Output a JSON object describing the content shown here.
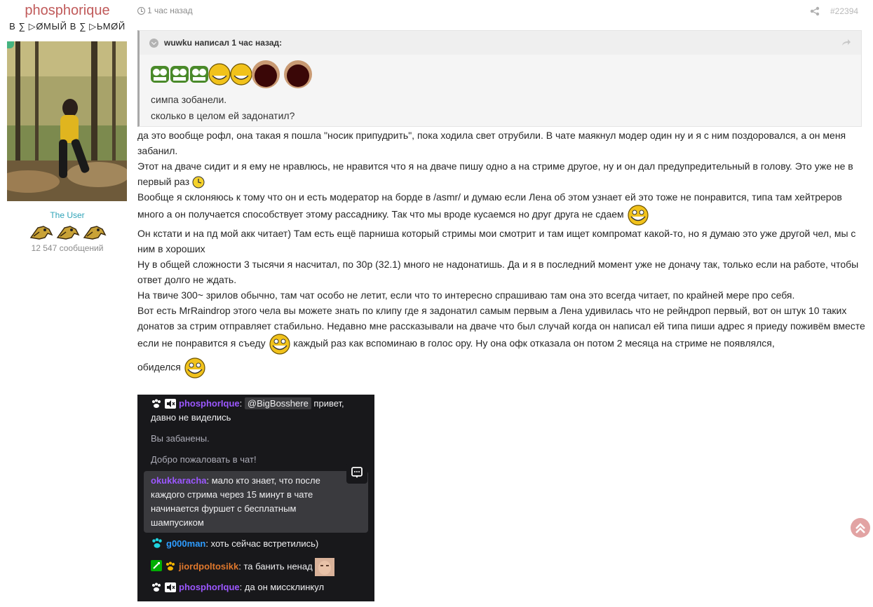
{
  "user": {
    "name": "phosphorique",
    "tagline": "В ∑ ▷ØМЫЙ В ∑ ▷ЬМØЙ",
    "role": "The User",
    "post_count": "12 547 сообщений",
    "badge_icons": [
      "pixel-bird-icon",
      "pixel-bird-icon",
      "pixel-bird-icon"
    ]
  },
  "post": {
    "time": "1 час назад",
    "number": "#22394"
  },
  "quote": {
    "author": "wuwku написал 1 час назад:",
    "emotes": [
      "pepe-laugh-icon",
      "pepe-laugh-icon",
      "pepe-laugh-icon",
      "troll-face-icon",
      "troll-face-icon",
      "screaming-face-icon",
      "screaming-face-icon"
    ],
    "lines": [
      "симпа зобанели.",
      "сколько в целом ей задонатил?"
    ]
  },
  "body": {
    "p1": "да это вообще рофл, она такая я пошла \"носик припудрить\", пока ходила свет отрубили. В чате маякнул модер один ну и я с ним поздоровался, а он меня забанил.",
    "p2": "Этот на дваче сидит и я ему не нравлюсь, не нравится что я на дваче пишу одно а на стриме другое, ну и он дал предупредительный в голову. Это уже не в первый раз",
    "p3": "Вообще я склоняюсь к тому что он и есть модератор на борде в /asmr/ и думаю если Лена об этом узнает ей это тоже не понравится, типа там хейтреров много а он получается способствует этому рассаднику. Так что мы вроде кусаемся но друг друга не сдаем",
    "p4": "Он кстати и на пд мой акк читает) Там есть ещё парниша который стримы мои смотрит и там ищет компромат какой-то, но я думаю это уже другой чел, мы с ним в хороших",
    "p5": "Ну в общей сложности 3 тысячи я насчитал, по 30р (32.1) много не надонатишь. Да и я в последний момент уже не доначу так, только если на работе, чтобы ответ долго не ждать.",
    "p6": "На твиче 300~ зрилов обычно, там чат особо не летит, если что то интересно спрашиваю там она это всегда читает, по крайней мере про себя.",
    "p7a": "Вот есть MrRaindrop этого чела вы можете знать по клипу где я задонатил самым первым а Лена удивилась что не рейндроп первый, вот он штук 10 таких донатов за стрим отправляет стабильно. Недавно мне рассказывали на дваче что был случай когда он написал ей типа пиши адрес я приеду поживём вместе если не понравится я съеду",
    "p7b": "каждый раз как вспоминаю в голос ору. Ну она офк отказала он потом 2 месяца на стриме не появлялся,",
    "p7c": "обиделся"
  },
  "chat": {
    "msg1_nick": "phosphorIque",
    "msg1_mention": "@BigBosshere",
    "msg1_text_a": " привет,",
    "msg1_text_b": "давно не виделись",
    "sys1": "Вы забанены.",
    "sys2": "Добро пожаловать в чат!",
    "msg2_nick": "okukkaracha",
    "msg2_lines": [
      "мало кто знает, что после",
      "каждого стрима через 15 минут в чате",
      "начинается фуршет с бесплатным",
      "шампусиком"
    ],
    "msg3_nick": "g000man",
    "msg3_text": "хоть сейчас встретились)",
    "msg4_nick": "jiordpoltosikk",
    "msg4_text": "та банить ненад",
    "msg5_nick": "phosphorIque",
    "msg5_text": "да он миссклинкул",
    "colors": {
      "purple": "#9b57ff",
      "blue": "#2e9cff",
      "orange": "#e0782d",
      "bg": "#18181b"
    }
  }
}
